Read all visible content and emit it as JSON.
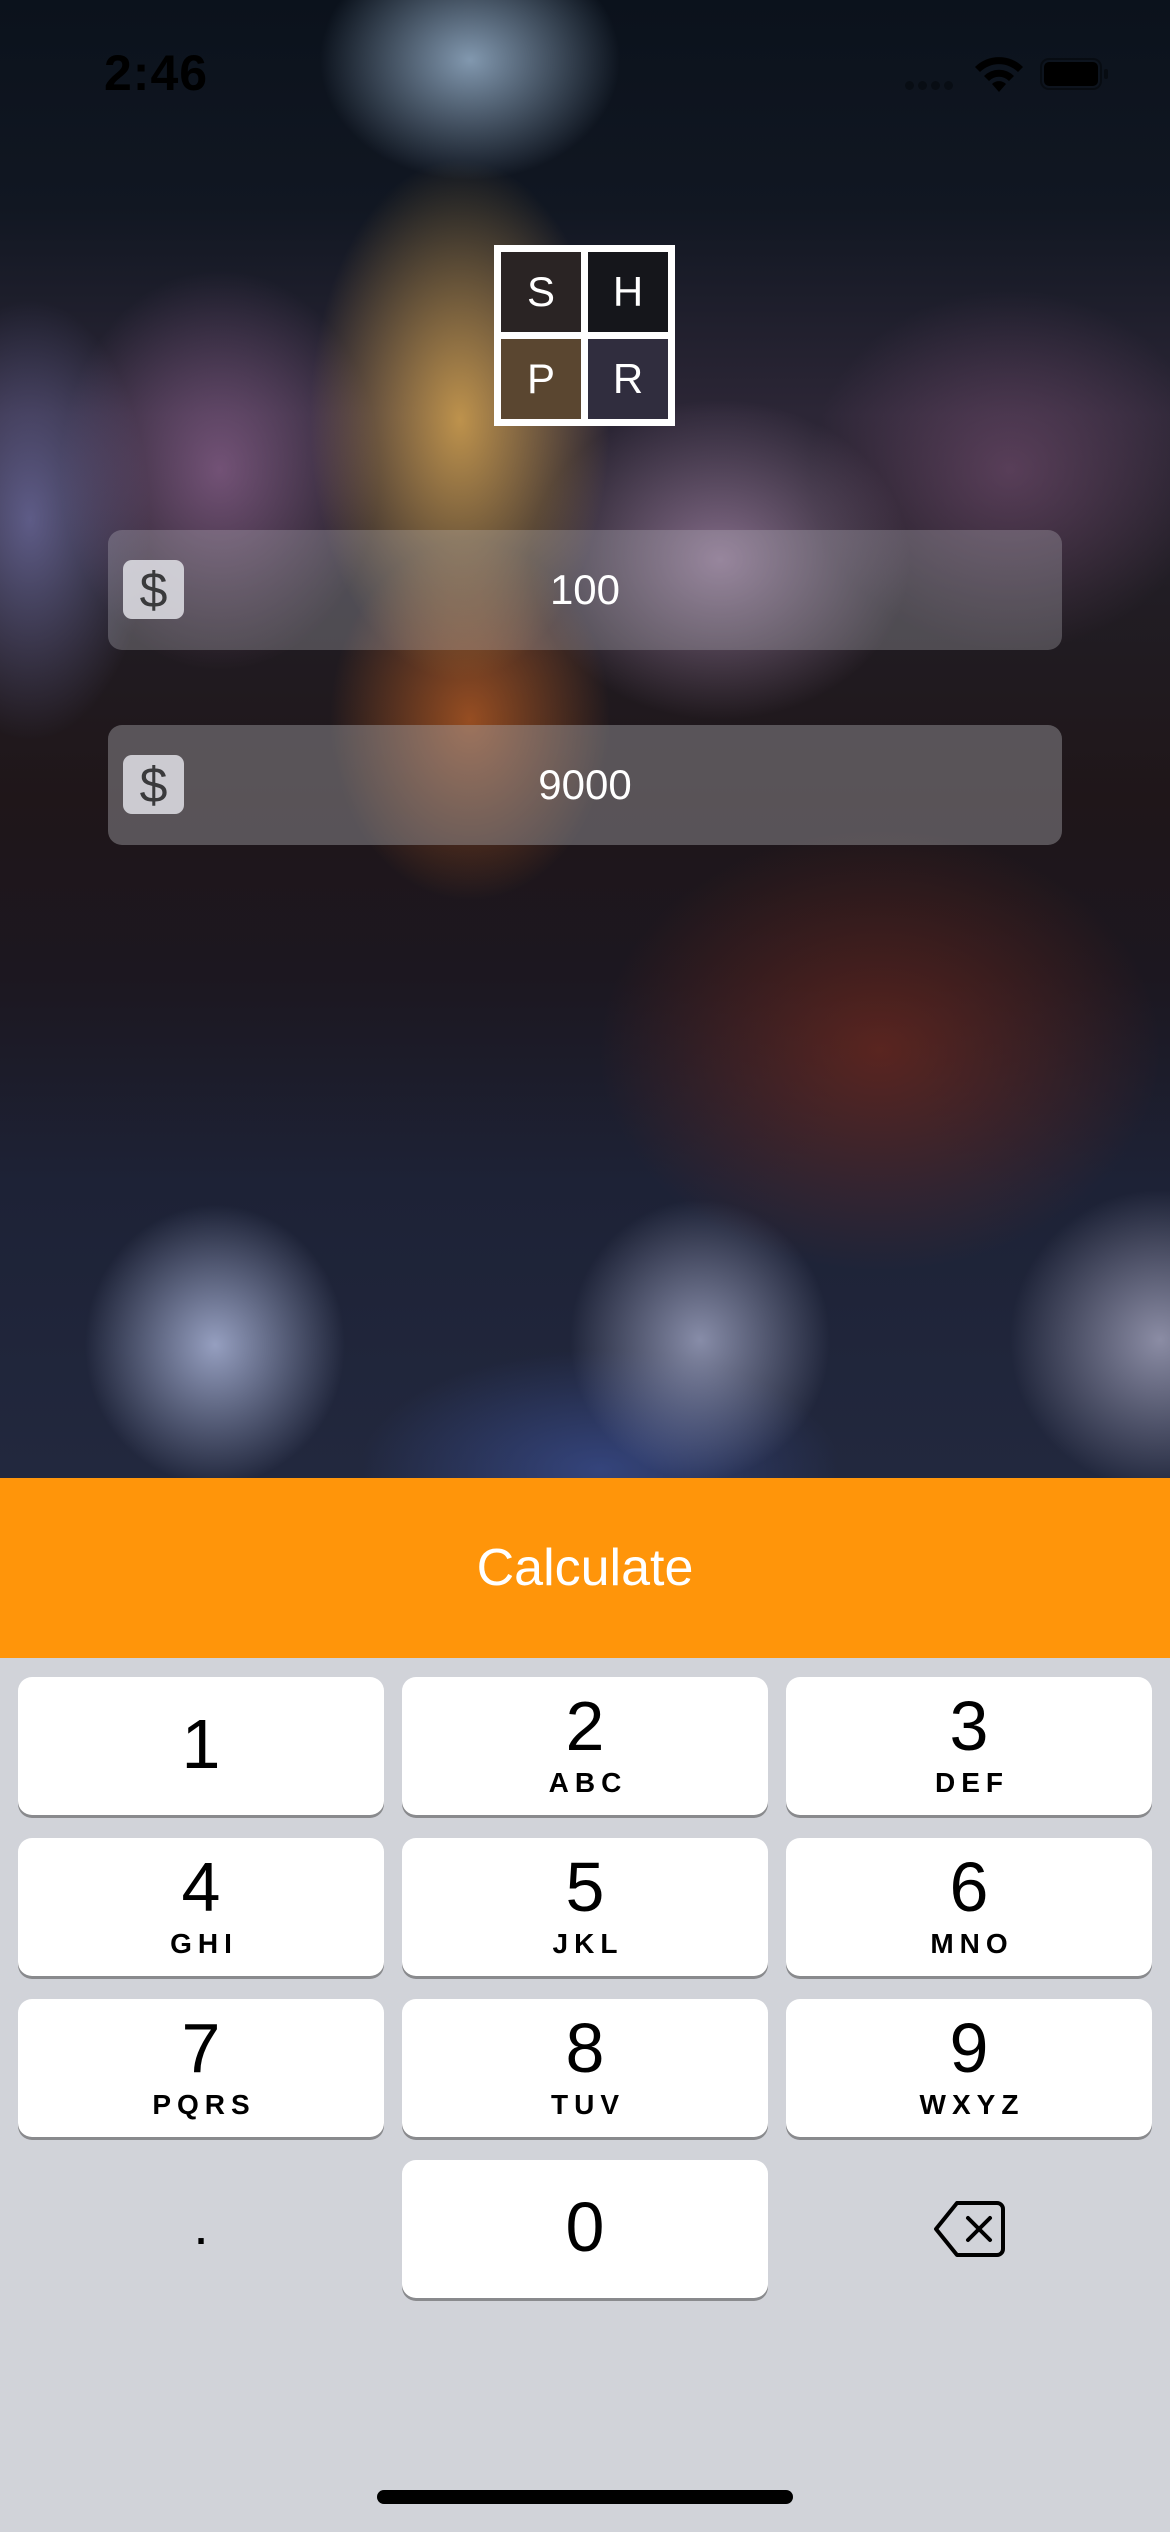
{
  "status_bar": {
    "time": "2:46",
    "icons": [
      "cellular-signal-icon",
      "wifi-icon",
      "battery-icon"
    ]
  },
  "logo": {
    "letters": [
      "S",
      "H",
      "P",
      "R"
    ]
  },
  "inputs": [
    {
      "prefix": "$",
      "value": "100"
    },
    {
      "prefix": "$",
      "value": "9000"
    }
  ],
  "actions": {
    "calculate_label": "Calculate",
    "accent_color": "#ff950a"
  },
  "keypad": {
    "keys": [
      {
        "digit": "1",
        "letters": ""
      },
      {
        "digit": "2",
        "letters": "ABC"
      },
      {
        "digit": "3",
        "letters": "DEF"
      },
      {
        "digit": "4",
        "letters": "GHI"
      },
      {
        "digit": "5",
        "letters": "JKL"
      },
      {
        "digit": "6",
        "letters": "MNO"
      },
      {
        "digit": "7",
        "letters": "PQRS"
      },
      {
        "digit": "8",
        "letters": "TUV"
      },
      {
        "digit": "9",
        "letters": "WXYZ"
      },
      {
        "digit": "0",
        "letters": ""
      }
    ],
    "decimal_label": ".",
    "delete_icon": "backspace-icon"
  }
}
